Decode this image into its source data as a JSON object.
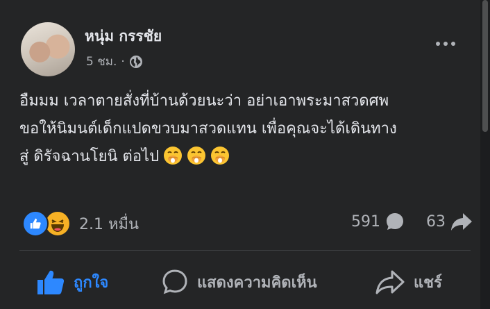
{
  "post": {
    "author": "หนุ่ม กรรชัย",
    "time": "5 ชม.",
    "separator": "·",
    "privacy_icon": "globe-icon",
    "more_icon": "more-horizontal-icon",
    "content_lines": [
      "อืมมม เวลาตายสั่งที่บ้านด้วยนะว่า อย่าเอาพระมาสวดศพ",
      "ขอให้นิมนต์เด็กแปดขวบมาสวดแทน เพื่อคุณจะได้เดินทาง",
      "สู่ ดิรัจฉานโยนิ ต่อไป"
    ],
    "content_emojis": [
      "face-with-hand-over-mouth",
      "face-with-hand-over-mouth",
      "face-with-hand-over-mouth"
    ]
  },
  "stats": {
    "reactions": [
      "like",
      "haha"
    ],
    "reaction_count": "2.1 หมื่น",
    "comments": "591",
    "shares": "63"
  },
  "actions": {
    "like": "ถูกใจ",
    "comment": "แสดงความคิดเห็น",
    "share": "แชร์"
  },
  "colors": {
    "background": "#242526",
    "text": "#e4e6eb",
    "secondary": "#b0b3b8",
    "like_active": "#2d88ff"
  }
}
